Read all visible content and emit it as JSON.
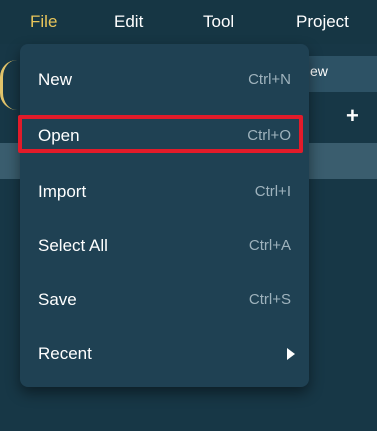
{
  "menubar": {
    "items": [
      {
        "label": "File",
        "active": true
      },
      {
        "label": "Edit"
      },
      {
        "label": "Tool"
      },
      {
        "label": "Project"
      }
    ]
  },
  "background": {
    "tab_label": "ew",
    "plus_label": "+"
  },
  "file_menu": {
    "items": [
      {
        "label": "New",
        "shortcut": "Ctrl+N"
      },
      {
        "label": "Open",
        "shortcut": "Ctrl+O",
        "highlighted": true
      },
      {
        "label": "Import",
        "shortcut": "Ctrl+I"
      },
      {
        "label": "Select All",
        "shortcut": "Ctrl+A"
      },
      {
        "label": "Save",
        "shortcut": "Ctrl+S"
      },
      {
        "label": "Recent",
        "submenu_icon": "chevron-right-icon"
      }
    ]
  },
  "colors": {
    "background": "#173746",
    "menu_background": "#1f4153",
    "active_menu_text": "#e8c55a",
    "highlight_border": "#e21b2a",
    "shortcut_text": "#9fb3bd"
  }
}
